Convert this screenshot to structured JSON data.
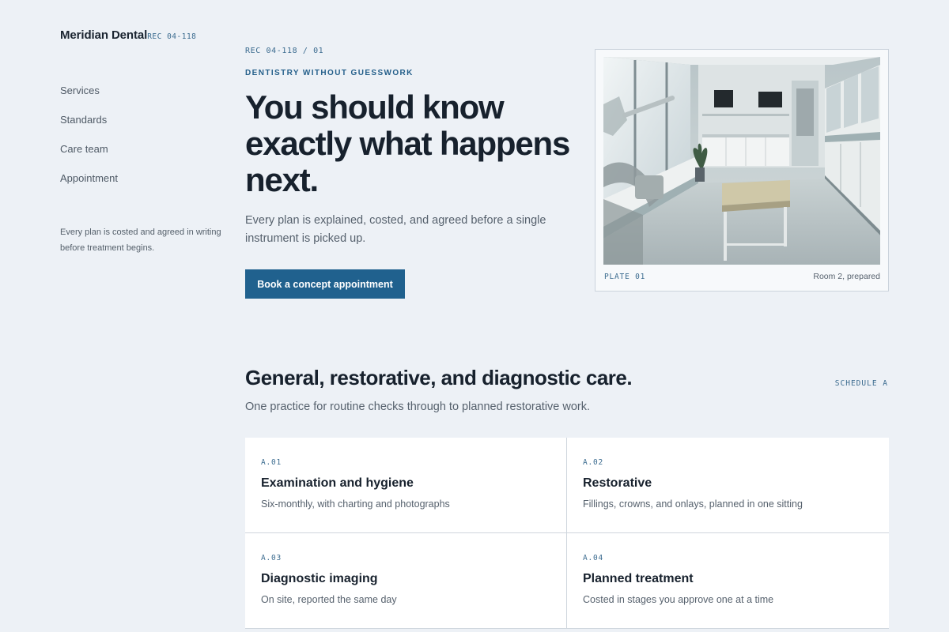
{
  "brand": {
    "name": "Meridian Dental",
    "rec": "REC 04-118"
  },
  "nav": [
    "Services",
    "Standards",
    "Care team",
    "Appointment"
  ],
  "side_note": "Every plan is costed and agreed in writing before treatment begins.",
  "hero": {
    "rec": "REC 04-118 / 01",
    "eyebrow": "DENTISTRY WITHOUT GUESSWORK",
    "headline": "You should know exactly what happens next.",
    "lead": "Every plan is explained, costed, and agreed before a single instrument is picked up.",
    "cta": "Book a concept appointment"
  },
  "plate": {
    "label": "PLATE 01",
    "caption": "Room 2, prepared"
  },
  "services": {
    "title": "General, restorative, and diagnostic care.",
    "schedule": "SCHEDULE A",
    "subtitle": "One practice for routine checks through to planned restorative work.",
    "items": [
      {
        "code": "A.01",
        "title": "Examination and hygiene",
        "desc": "Six-monthly, with charting and photographs"
      },
      {
        "code": "A.02",
        "title": "Restorative",
        "desc": "Fillings, crowns, and onlays, planned in one sitting"
      },
      {
        "code": "A.03",
        "title": "Diagnostic imaging",
        "desc": "On site, reported the same day"
      },
      {
        "code": "A.04",
        "title": "Planned treatment",
        "desc": "Costed in stages you approve one at a time"
      }
    ]
  },
  "colors": {
    "accent": "#20618e",
    "background": "#edf1f6",
    "mono_accent": "#3b6b8f"
  },
  "icons": [
    "clinic-room-photo"
  ]
}
